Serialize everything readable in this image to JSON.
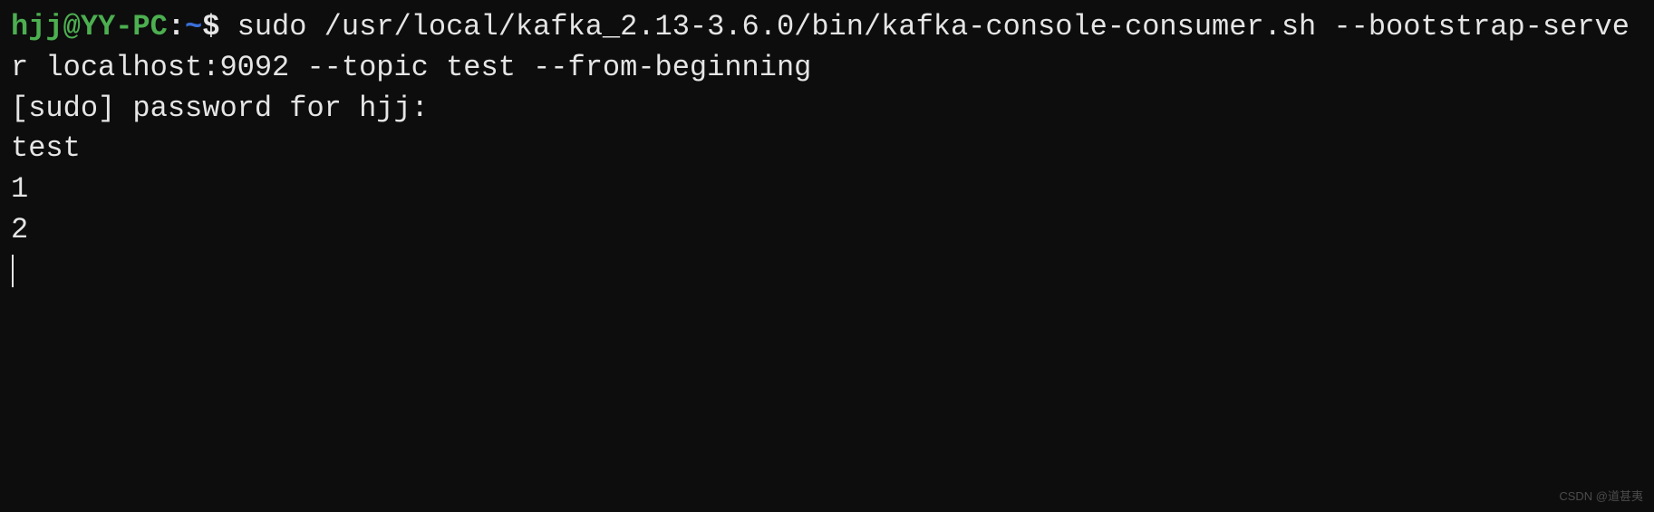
{
  "terminal": {
    "prompt": {
      "user": "hjj@YY-PC",
      "sep": ":",
      "path": "~",
      "symbol": "$"
    },
    "command": "sudo /usr/local/kafka_2.13-3.6.0/bin/kafka-console-consumer.sh --bootstrap-server localhost:9092 --topic test --from-beginning",
    "lines": [
      "[sudo] password for hjj: ",
      "test",
      "",
      "1",
      "2"
    ]
  },
  "watermark": "CSDN @道甚夷"
}
